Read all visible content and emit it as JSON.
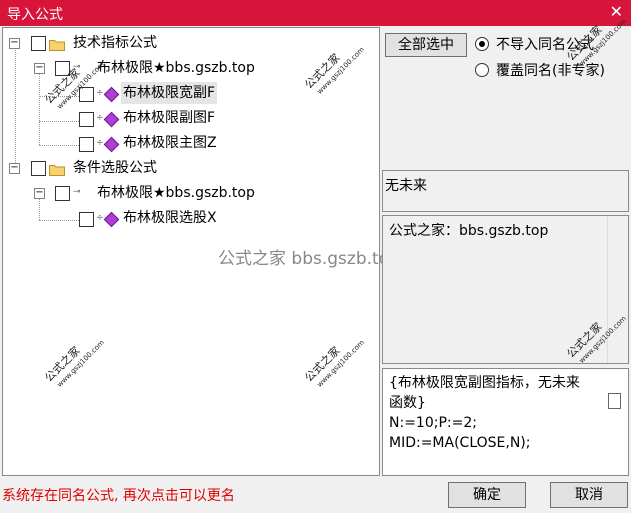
{
  "window": {
    "title": "导入公式",
    "close_glyph": "✕"
  },
  "tree": {
    "nodes": [
      {
        "label": "技术指标公式"
      },
      {
        "label": "布林极限★bbs.gszb.top"
      },
      {
        "label": "布林极限宽副F"
      },
      {
        "label": "布林极限副图F"
      },
      {
        "label": "布林极限主图Z"
      },
      {
        "label": "条件选股公式"
      },
      {
        "label": "布林极限★bbs.gszb.top"
      },
      {
        "label": "布林极限选股X"
      }
    ],
    "expand_glyph": "−"
  },
  "watermark": {
    "center": "公式之家 bbs.gszb.top",
    "stamp_title": "公式之家",
    "stamp_url": "www.gszj100.com"
  },
  "controls": {
    "select_all": "全部选中",
    "radio_skip": "不导入同名公式",
    "radio_overwrite": "覆盖同名(非专家)"
  },
  "panels": {
    "author": "无未来",
    "source": "公式之家：bbs.gszb.top",
    "code_lines": [
      "{布林极限宽副图指标，无未来",
      "函数}",
      "N:=10;P:=2;",
      "MID:=MA(CLOSE,N);"
    ]
  },
  "footer": {
    "status": "系统存在同名公式, 再次点击可以更名",
    "ok": "确定",
    "cancel": "取消"
  }
}
